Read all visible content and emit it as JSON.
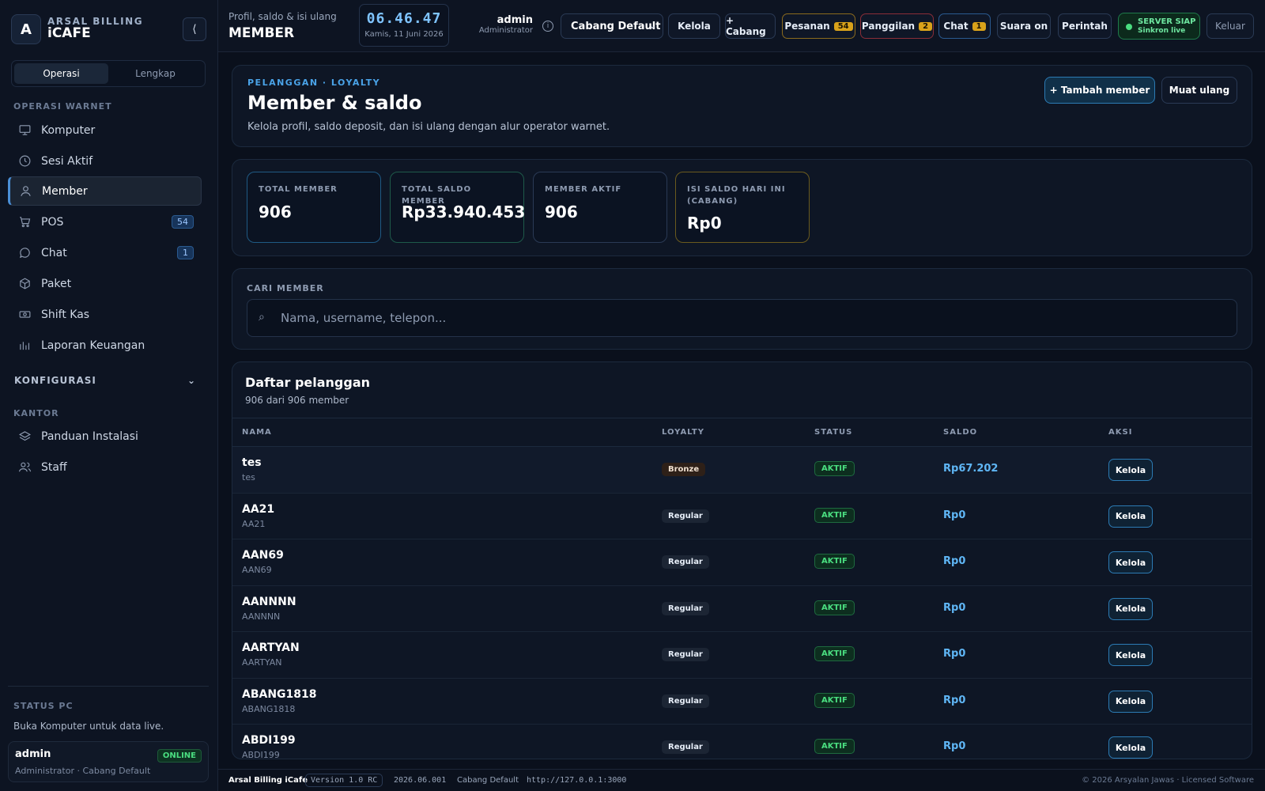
{
  "sidebar": {
    "logo_letter": "A",
    "brand_sub": "ARSAL BILLING",
    "brand_name": "iCAFE",
    "collapse_icon": "⟨",
    "modes": [
      "Operasi",
      "Lengkap"
    ],
    "section_ops": "OPERASI WARNET",
    "items": [
      {
        "label": "Komputer",
        "icon": "monitor-icon"
      },
      {
        "label": "Sesi Aktif",
        "icon": "clock-icon"
      },
      {
        "label": "Member",
        "icon": "user-icon"
      },
      {
        "label": "POS",
        "icon": "cart-icon",
        "badge": "54"
      },
      {
        "label": "Chat",
        "icon": "chat-icon",
        "badge": "1"
      },
      {
        "label": "Paket",
        "icon": "box-icon"
      },
      {
        "label": "Shift Kas",
        "icon": "cash-icon"
      },
      {
        "label": "Laporan Keuangan",
        "icon": "bar-chart-icon"
      }
    ],
    "config_label": "KONFIGURASI",
    "section_office": "KANTOR",
    "office_items": [
      {
        "label": "Panduan Instalasi",
        "icon": "layers-icon"
      },
      {
        "label": "Staff",
        "icon": "users-icon"
      }
    ],
    "status_pc_label": "STATUS PC",
    "status_pc_hint": "Buka Komputer untuk data live.",
    "user": {
      "name": "admin",
      "role": "Administrator · Cabang Default",
      "status": "ONLINE"
    }
  },
  "topbar": {
    "subtitle": "Profil, saldo & isi ulang",
    "title": "MEMBER",
    "time": "06.46.47",
    "date": "Kamis, 11 Juni 2026",
    "user_name": "admin",
    "user_role": "Administrator",
    "branch": "Cabang Default",
    "kelola": "Kelola",
    "add_branch": "+ Cabang",
    "pesanan": "Pesanan",
    "pesanan_count": "54",
    "panggilan": "Panggilan",
    "panggilan_count": "2",
    "chat": "Chat",
    "chat_count": "1",
    "suara": "Suara on",
    "perintah": "Perintah",
    "server_l1": "SERVER SIAP",
    "server_l2": "Sinkron live",
    "logout": "Keluar"
  },
  "hero": {
    "eyebrow": "PELANGGAN · LOYALTY",
    "title": "Member & saldo",
    "desc": "Kelola profil, saldo deposit, dan isi ulang dengan alur operator warnet.",
    "add_btn": "+ Tambah member",
    "reload_btn": "Muat ulang"
  },
  "stats": [
    {
      "label": "TOTAL MEMBER",
      "value": "906"
    },
    {
      "label": "TOTAL SALDO MEMBER",
      "value": "Rp33.940.453"
    },
    {
      "label": "MEMBER AKTIF",
      "value": "906"
    },
    {
      "label": "ISI SALDO HARI INI (CABANG)",
      "value": "Rp0"
    }
  ],
  "search": {
    "label": "CARI MEMBER",
    "placeholder": "Nama, username, telepon..."
  },
  "list": {
    "title": "Daftar pelanggan",
    "count": "906 dari 906 member",
    "headers": [
      "NAMA",
      "LOYALTY",
      "STATUS",
      "SALDO",
      "AKSI"
    ],
    "rows": [
      {
        "name": "tes",
        "username": "tes",
        "loyalty": "Bronze",
        "status": "AKTIF",
        "saldo": "Rp67.202",
        "action": "Kelola"
      },
      {
        "name": "AA21",
        "username": "AA21",
        "loyalty": "Regular",
        "status": "AKTIF",
        "saldo": "Rp0",
        "action": "Kelola"
      },
      {
        "name": "AAN69",
        "username": "AAN69",
        "loyalty": "Regular",
        "status": "AKTIF",
        "saldo": "Rp0",
        "action": "Kelola"
      },
      {
        "name": "AANNNN",
        "username": "AANNNN",
        "loyalty": "Regular",
        "status": "AKTIF",
        "saldo": "Rp0",
        "action": "Kelola"
      },
      {
        "name": "AARTYAN",
        "username": "AARTYAN",
        "loyalty": "Regular",
        "status": "AKTIF",
        "saldo": "Rp0",
        "action": "Kelola"
      },
      {
        "name": "ABANG1818",
        "username": "ABANG1818",
        "loyalty": "Regular",
        "status": "AKTIF",
        "saldo": "Rp0",
        "action": "Kelola"
      },
      {
        "name": "ABDI199",
        "username": "ABDI199",
        "loyalty": "Regular",
        "status": "AKTIF",
        "saldo": "Rp0",
        "action": "Kelola"
      }
    ]
  },
  "footer": {
    "brand": "Arsal Billing iCafe",
    "version": "Version 1.0 RC",
    "build": "2026.06.001",
    "branch": "Cabang Default",
    "url": "http://127.0.0.1:3000",
    "copyright": "© 2026 Arsyalan Jawas · Licensed Software"
  }
}
